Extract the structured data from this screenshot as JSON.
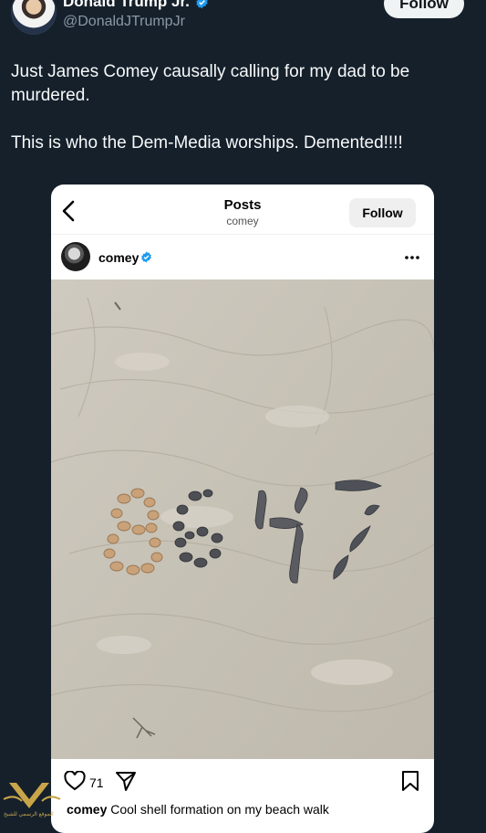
{
  "tweet": {
    "display_name": "Donald Trump Jr.",
    "handle": "@DonaldJTrumpJr",
    "follow_label": "Follow",
    "text_lines": [
      "Just James Comey causally calling for my dad to be murdered.",
      "This is who the Dem-Media worships. Demented!!!!"
    ]
  },
  "instagram": {
    "header_title": "Posts",
    "header_subtitle": "comey",
    "follow_label": "Follow",
    "username": "comey",
    "likes": "71",
    "caption_user": "comey",
    "caption_text": "Cool shell formation on my beach walk",
    "shell_text": "8647"
  },
  "watermark": {
    "text": "الموقع الرسمي للشيخ"
  },
  "colors": {
    "background": "#15202b",
    "verified": "#1d9bf0",
    "sand": "#c9c4b8"
  }
}
